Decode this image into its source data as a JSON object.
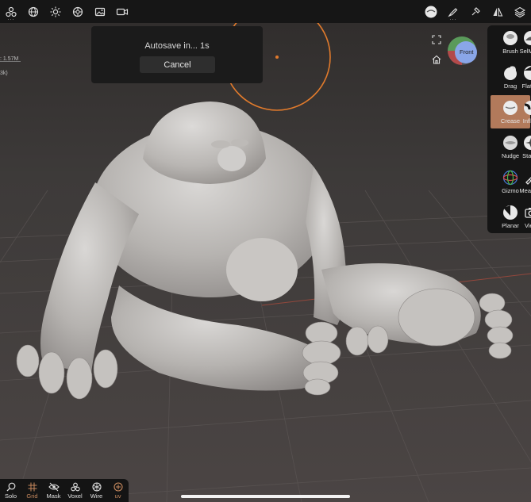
{
  "toolbar": {
    "left_icons": [
      "scene-icon",
      "globe-icon",
      "light-icon",
      "material-icon",
      "image-icon",
      "camera-icon"
    ],
    "right_icons": [
      "tool-preview-icon",
      "brush-icon",
      "paint-icon",
      "symmetry-icon",
      "layers-icon"
    ]
  },
  "autosave": {
    "message": "Autosave in... 1s",
    "cancel_label": "Cancel"
  },
  "stats": {
    "vertices": "1.57M",
    "faces": "3k)"
  },
  "gizmo": {
    "front_label": "Front"
  },
  "tools": [
    {
      "label": "Brush",
      "icon": "brush-sphere-icon"
    },
    {
      "label": "SelMask",
      "icon": "selmask-icon"
    },
    {
      "label": "Drag",
      "icon": "drag-icon"
    },
    {
      "label": "Flatten",
      "icon": "flatten-icon"
    },
    {
      "label": "Crease",
      "icon": "crease-icon",
      "active": true
    },
    {
      "label": "Inflate",
      "icon": "inflate-icon"
    },
    {
      "label": "Nudge",
      "icon": "nudge-icon"
    },
    {
      "label": "Stamp",
      "icon": "stamp-icon"
    },
    {
      "label": "Gizmo",
      "icon": "gizmo-icon"
    },
    {
      "label": "Measure",
      "icon": "measure-icon"
    },
    {
      "label": "Planar",
      "icon": "planar-icon"
    },
    {
      "label": "View",
      "icon": "view-camera-icon"
    }
  ],
  "bottom_bar": [
    {
      "label": "Solo",
      "icon": "search-icon"
    },
    {
      "label": "Grid",
      "icon": "grid-icon",
      "active": true
    },
    {
      "label": "Mask",
      "icon": "eye-slash-icon"
    },
    {
      "label": "Voxel",
      "icon": "voxel-icon"
    },
    {
      "label": "Wire",
      "icon": "wire-icon"
    },
    {
      "label": "uv",
      "icon": "uv-icon",
      "active": true
    }
  ],
  "colors": {
    "accent": "#b27a5b",
    "orange_ring": "#e07a2c",
    "toolbar_bg": "#161616"
  }
}
